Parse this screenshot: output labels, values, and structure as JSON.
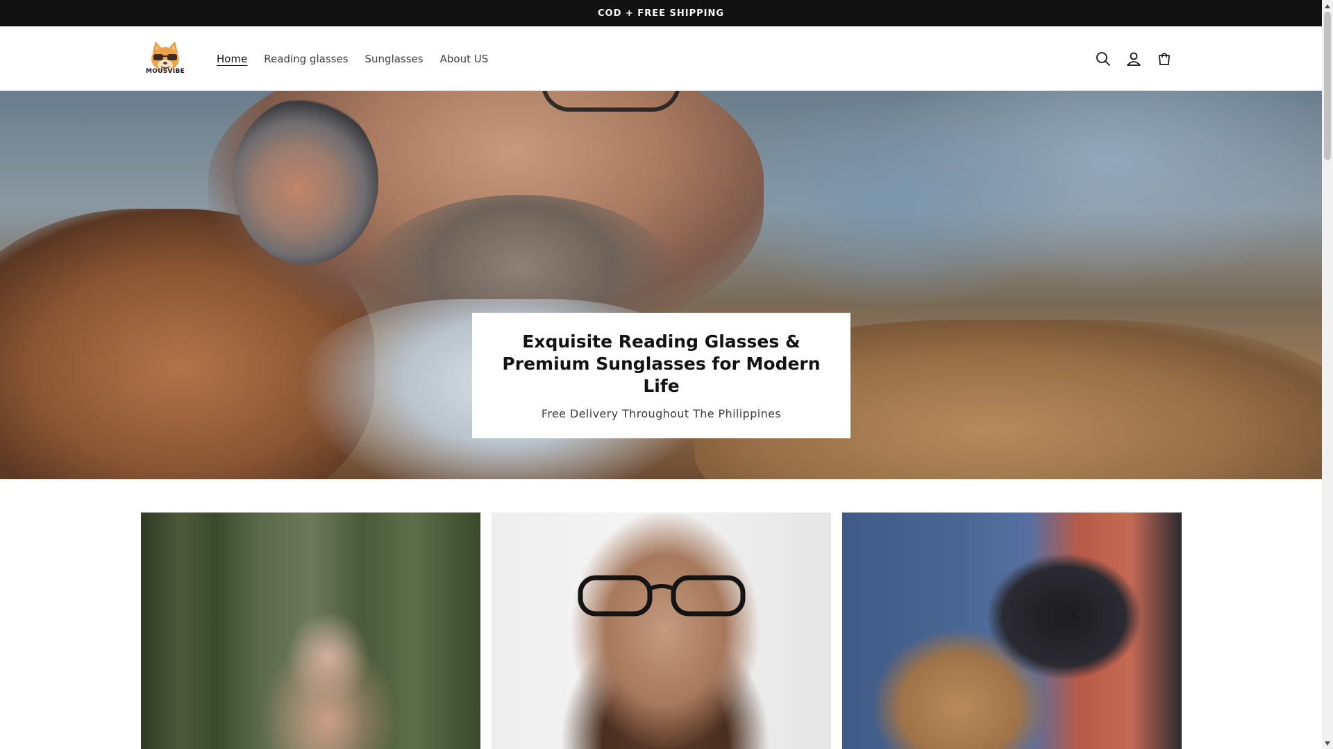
{
  "announcement": {
    "text": "COD + FREE SHIPPING"
  },
  "header": {
    "logo_text": "MOUSVIBE",
    "nav": [
      {
        "label": "Home",
        "active": true
      },
      {
        "label": "Reading glasses",
        "active": false
      },
      {
        "label": "Sunglasses",
        "active": false
      },
      {
        "label": "About US",
        "active": false
      }
    ],
    "icons": [
      "search-icon",
      "account-icon",
      "cart-icon"
    ]
  },
  "hero": {
    "title": "Exquisite Reading Glasses & Premium Sunglasses for Modern Life",
    "subtitle": "Free Delivery Throughout The Philippines"
  },
  "collections": [
    {
      "image": "woman-laughing-glasses-forest"
    },
    {
      "image": "bearded-man-adjusting-glasses"
    },
    {
      "image": "package-delivery-handoff"
    }
  ],
  "colors": {
    "announcement_bg": "#121212",
    "text": "#121212",
    "nav_text": "#3d3d3d"
  }
}
